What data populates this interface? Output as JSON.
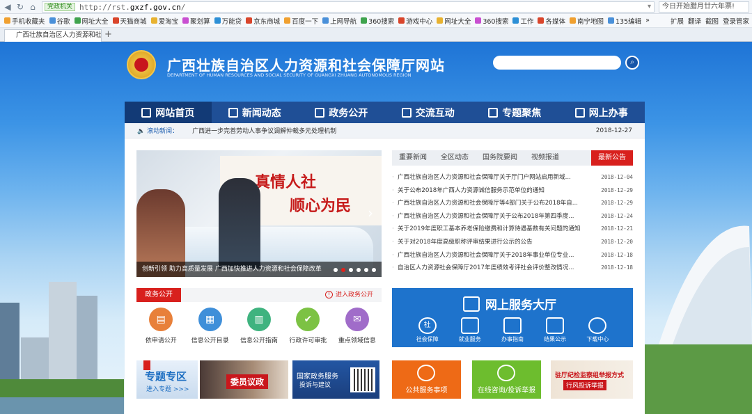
{
  "browser": {
    "gov_badge": "党政机关",
    "url_prefix": "http://rst.",
    "url_domain": "gxzf.gov.cn",
    "url_suffix": "/",
    "ticker": "今日开始腊月廿六年票!",
    "bookmarks": [
      "手机收藏夹",
      "谷歌",
      "网址大全",
      "天猫商城",
      "爱淘宝",
      "聚划算",
      "万能贷",
      "京东商城",
      "百度一下",
      "上网导航",
      "360搜索",
      "游戏中心",
      "网址大全",
      "360搜索",
      "工作",
      "各媒体",
      "南宁地图",
      "135编辑"
    ],
    "bookmark_more": "»",
    "toolbar_right": [
      "扩展",
      "翻译",
      "截图",
      "登录管家"
    ],
    "tab_title": "广西壮族自治区人力资源和社",
    "tab_close": "×",
    "new_tab": "+"
  },
  "header": {
    "title": "广西壮族自治区人力资源和社会保障厅网站",
    "subtitle": "DEPARTMENT OF HUMAN RESOURCES AND SOCIAL SECURITY OF GUANGXI ZHUANG AUTONOMOUS REGION"
  },
  "nav": [
    "网站首页",
    "新闻动态",
    "政务公开",
    "交流互动",
    "专题聚焦",
    "网上办事"
  ],
  "scroll_news": {
    "label": "滚动新闻：",
    "text": "广西进一步完善劳动人事争议调解仲裁多元处理机制",
    "date": "2018-12-27"
  },
  "slider": {
    "caption": "创新引领  助力高质量发展  广西加快推进人力资源和社会保障改革",
    "banner_line1": "真情人社",
    "banner_line2": "顺心为民",
    "dots": 6,
    "active_dot": 1
  },
  "news": {
    "tabs": [
      "重要新闻",
      "全区动态",
      "国务院要闻",
      "视频报道",
      "最新公告"
    ],
    "active_tab": 4,
    "items": [
      {
        "title": "广西壮族自治区人力资源和社会保障厅关于厅门户网站启用新域...",
        "date": "2018-12-04"
      },
      {
        "title": "关于公布2018年广西人力资源诚信服务示范单位的通知",
        "date": "2018-12-29"
      },
      {
        "title": "广西壮族自治区人力资源和社会保障厅等4部门关于公布2018年自...",
        "date": "2018-12-29"
      },
      {
        "title": "广西壮族自治区人力资源和社会保障厅关于公布2018年第四季度...",
        "date": "2018-12-24"
      },
      {
        "title": "关于2019年度职工基本养老保险缴费和计算待遇基数有关问题的通知",
        "date": "2018-12-21"
      },
      {
        "title": "关于对2018年度高级职称评审结果进行公示的公告",
        "date": "2018-12-20"
      },
      {
        "title": "广西壮族自治区人力资源和社会保障厅关于2018年事业单位专业...",
        "date": "2018-12-18"
      },
      {
        "title": "自治区人力资源社会保障厅2017年度绩效考评社会评价整改情况...",
        "date": "2018-12-18"
      }
    ]
  },
  "gov_open": {
    "label": "政务公开",
    "link": "进入政务公开",
    "items": [
      {
        "label": "依申请公开",
        "color": "#e8803a"
      },
      {
        "label": "信息公开目录",
        "color": "#3f8fd9"
      },
      {
        "label": "信息公开指南",
        "color": "#3fb37f"
      },
      {
        "label": "行政许可审批",
        "color": "#7cc244"
      },
      {
        "label": "重点领域信息",
        "color": "#a06cc9"
      }
    ]
  },
  "service_hall": {
    "title": "网上服务大厅",
    "items": [
      "社会保障",
      "就业服务",
      "办事指南",
      "结果公示",
      "下载中心"
    ],
    "item_glyphs": [
      "社",
      "",
      "",
      "",
      ""
    ]
  },
  "banners": {
    "topic_big": "专题专区",
    "topic_small": "进入专题 >>>",
    "committee": "委员议政",
    "gov_service_line1": "国家政务服务",
    "gov_service_line2": "投诉与建议",
    "public_service": "公共服务事项",
    "online_consult": "在线咨询/投诉举报",
    "discipline_line1": "驻厅纪检监察组举报方式",
    "discipline_line2": "行风投诉举报"
  },
  "colors": {
    "nav_bg": "#1f4f96",
    "accent_red": "#d8201d",
    "hall_blue": "#1e73cc",
    "public_service_orange": "#ee6a16",
    "consult_green": "#6dbd2e"
  }
}
